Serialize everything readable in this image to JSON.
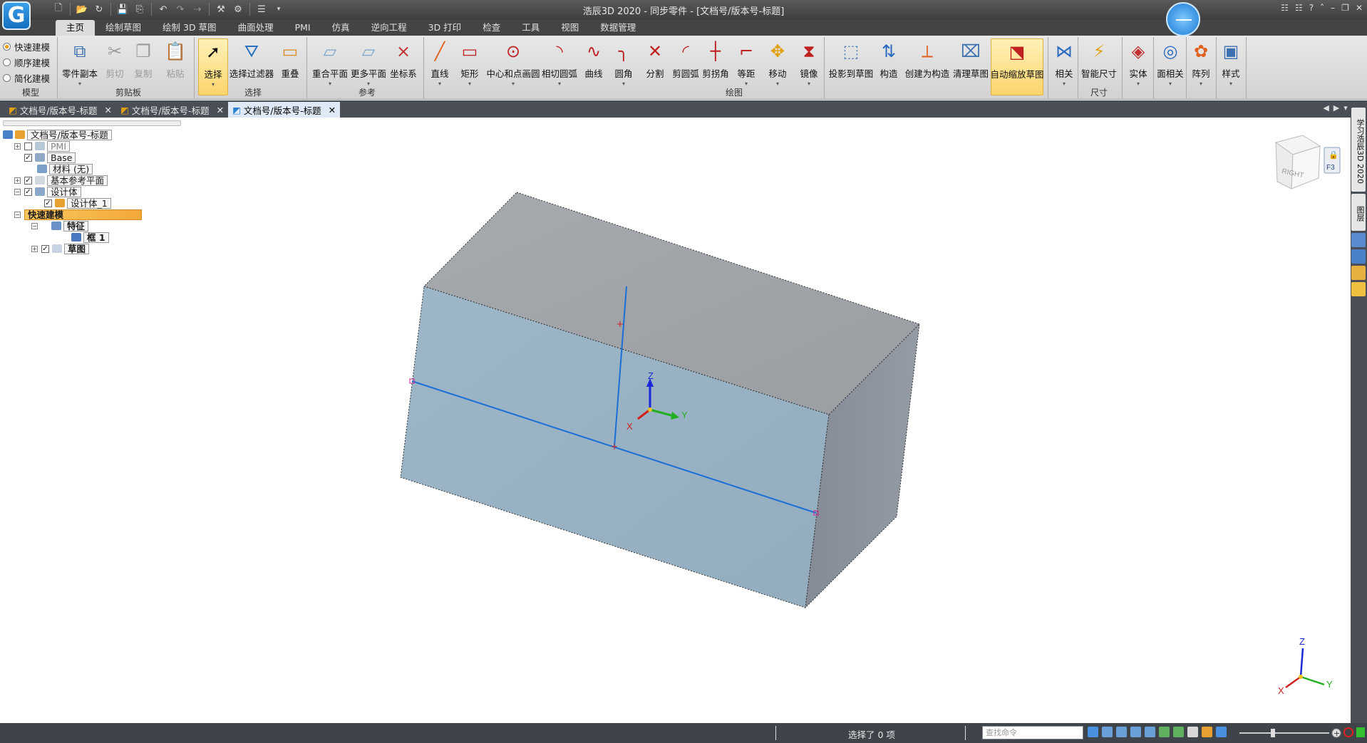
{
  "window": {
    "title": "浩辰3D 2020 - 同步零件 - [文档号/版本号-标题]",
    "logo_letter": "G"
  },
  "menu_tabs": [
    "主页",
    "绘制草图",
    "绘制 3D 草图",
    "曲面处理",
    "PMI",
    "仿真",
    "逆向工程",
    "3D 打印",
    "检查",
    "工具",
    "视图",
    "数据管理"
  ],
  "modeling_modes": [
    "快速建模",
    "顺序建模",
    "简化建模"
  ],
  "ribbon_groups": {
    "model": "模型",
    "clipboard": "剪贴板",
    "select": "选择",
    "reference": "参考",
    "draw": "绘图",
    "dimension": "尺寸"
  },
  "ribbon_buttons": {
    "part_copy": "零件副本",
    "cut": "剪切",
    "copy": "复制",
    "paste": "粘贴",
    "select": "选择",
    "select_filter": "选择过滤器",
    "overlap": "重叠",
    "coincident_plane": "重合平面",
    "more_planes": "更多平面",
    "coord_sys": "坐标系",
    "line": "直线",
    "rectangle": "矩形",
    "center_circle": "中心和点画圆",
    "tangent_arc": "相切圆弧",
    "curve": "曲线",
    "fillet": "圆角",
    "split": "分割",
    "trim": "剪圆弧",
    "trim_corner": "剪拐角",
    "offset": "等距",
    "move": "移动",
    "mirror": "镜像",
    "project": "投影到草图",
    "construct": "构造",
    "create_construct": "创建为构造",
    "clean_sketch": "清理草图",
    "auto_zoom": "自动缩放草图",
    "relate": "相关",
    "smart_dim": "智能尺寸",
    "solid": "实体",
    "face_relate": "面相关",
    "array": "阵列",
    "style": "样式"
  },
  "doc_tabs": [
    {
      "label": "文档号/版本号-标题",
      "active": false
    },
    {
      "label": "文档号/版本号-标题",
      "active": false
    },
    {
      "label": "文档号/版本号-标题",
      "active": true
    }
  ],
  "tree": {
    "root": "文档号/版本号-标题",
    "pmi": "PMI",
    "base": "Base",
    "material": "材料 (无)",
    "base_planes": "基本参考平面",
    "design_body": "设计体",
    "design_body_1": "设计体_1",
    "quick_modeling": "快速建模",
    "features": "特征",
    "box": "框 1",
    "sketch": "草图"
  },
  "viewcube": {
    "face": "RIGHT",
    "shortcut": "F3"
  },
  "axes": {
    "x": "X",
    "y": "Y",
    "z": "Z"
  },
  "right_strip": [
    "学习浩辰3D 2020",
    "图层"
  ],
  "status": {
    "text": "选择了 0 项",
    "search_placeholder": "查找命令"
  },
  "colors": {
    "box_top": "#a0a4a8",
    "box_front": "#9ab5c6",
    "box_side": "#8b919c",
    "sketch_line": "#1a6fd6",
    "tree_highlight": "#f3a83a"
  }
}
